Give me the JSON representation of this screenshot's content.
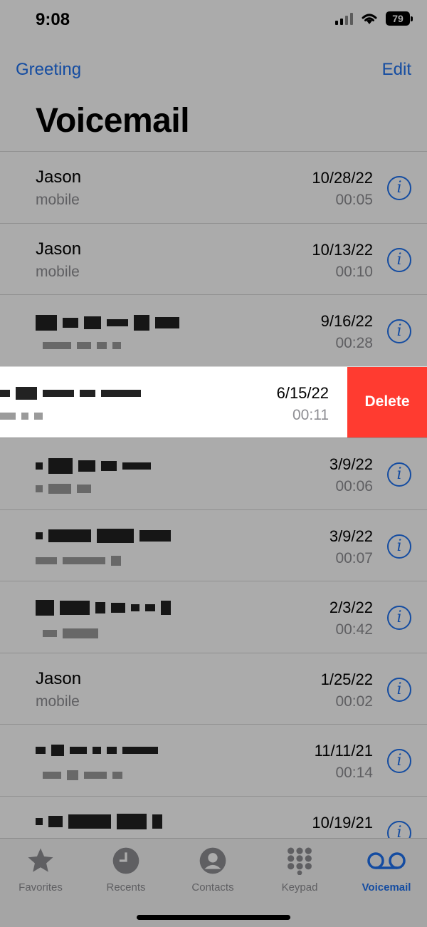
{
  "status": {
    "time": "9:08",
    "battery": "79"
  },
  "nav": {
    "left": "Greeting",
    "right": "Edit"
  },
  "title": "Voicemail",
  "voicemails": [
    {
      "name": "Jason",
      "label": "mobile",
      "date": "10/28/22",
      "duration": "00:05"
    },
    {
      "name": "Jason",
      "label": "mobile",
      "date": "10/13/22",
      "duration": "00:10"
    },
    {
      "name": "",
      "label": "",
      "date": "9/16/22",
      "duration": "00:28"
    },
    {
      "name": "",
      "label": "",
      "date": "6/15/22",
      "duration": "00:11"
    },
    {
      "name": "",
      "label": "",
      "date": "3/9/22",
      "duration": "00:06"
    },
    {
      "name": "",
      "label": "",
      "date": "3/9/22",
      "duration": "00:07"
    },
    {
      "name": "",
      "label": "",
      "date": "2/3/22",
      "duration": "00:42"
    },
    {
      "name": "Jason",
      "label": "mobile",
      "date": "1/25/22",
      "duration": "00:02"
    },
    {
      "name": "",
      "label": "",
      "date": "11/11/21",
      "duration": "00:14"
    },
    {
      "name": "",
      "label": "",
      "date": "10/19/21",
      "duration": ""
    }
  ],
  "swipe_action": {
    "label": "Delete",
    "color": "#ff3b30"
  },
  "tabs": [
    {
      "label": "Favorites",
      "icon": "star-icon"
    },
    {
      "label": "Recents",
      "icon": "clock-icon"
    },
    {
      "label": "Contacts",
      "icon": "person-icon"
    },
    {
      "label": "Keypad",
      "icon": "keypad-icon"
    },
    {
      "label": "Voicemail",
      "icon": "voicemail-icon",
      "active": true
    }
  ],
  "colors": {
    "accent": "#1f72f0",
    "secondary_text": "#8e8e93"
  }
}
